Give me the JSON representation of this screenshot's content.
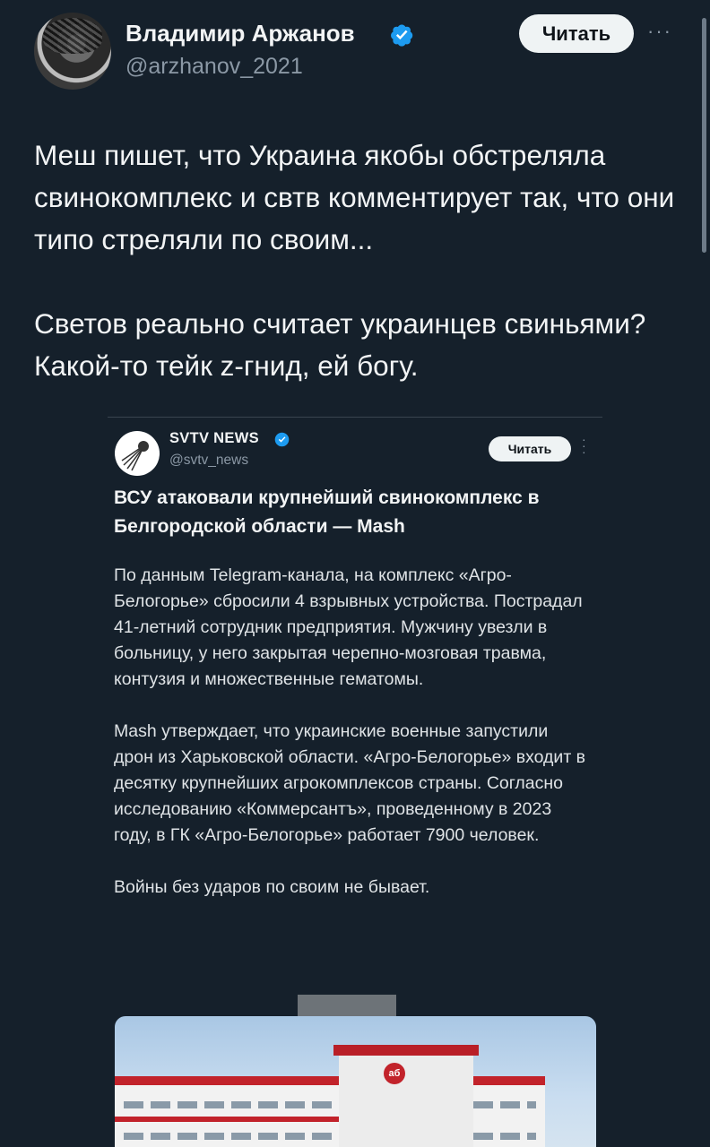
{
  "author": {
    "name": "Владимир Аржанов",
    "handle": "@arzhanov_2021",
    "verified": true,
    "follow_label": "Читать",
    "more_icon": "more-dots-icon"
  },
  "tweet": {
    "paragraphs": [
      "Меш пишет, что Украина якобы обстреляла свинокомплекс и свтв комментирует так, что они типо стреляли по своим...",
      "Светов реально считает украинцев свиньями? Какой-то тейк z-гнид, ей богу."
    ]
  },
  "quoted_post": {
    "name": "SVTV NEWS",
    "handle": "@svtv_news",
    "verified": true,
    "follow_label": "Читать",
    "title": "ВСУ атаковали крупнейший свинокомплекс в Белгородской области — Mash",
    "paragraphs": [
      "По данным Telegram-канала, на комплекс «Агро-Белогорье» сбросили 4 взрывных устройства. Пострадал 41-летний сотрудник предприятия. Мужчину увезли в больницу, у него закрытая черепно-мозговая травма, контузия и множественные гематомы.",
      "Mash утверждает, что украинские военные запустили дрон из Харьковской области. «Агро-Белогорье» входит в десятку крупнейших агрокомплексов страны. Согласно исследованию «Коммерсантъ», проведенному в 2023 году, в ГК «Агро-Белогорье» работает 7900 человек.",
      "Войны без ударов по своим не бывает."
    ],
    "media_emblem": "аб"
  },
  "colors": {
    "background": "#15202b",
    "text": "#f2f4f5",
    "secondary": "#8b98a5",
    "verified": "#1d9bf0",
    "brand_red": "#c2232b"
  }
}
